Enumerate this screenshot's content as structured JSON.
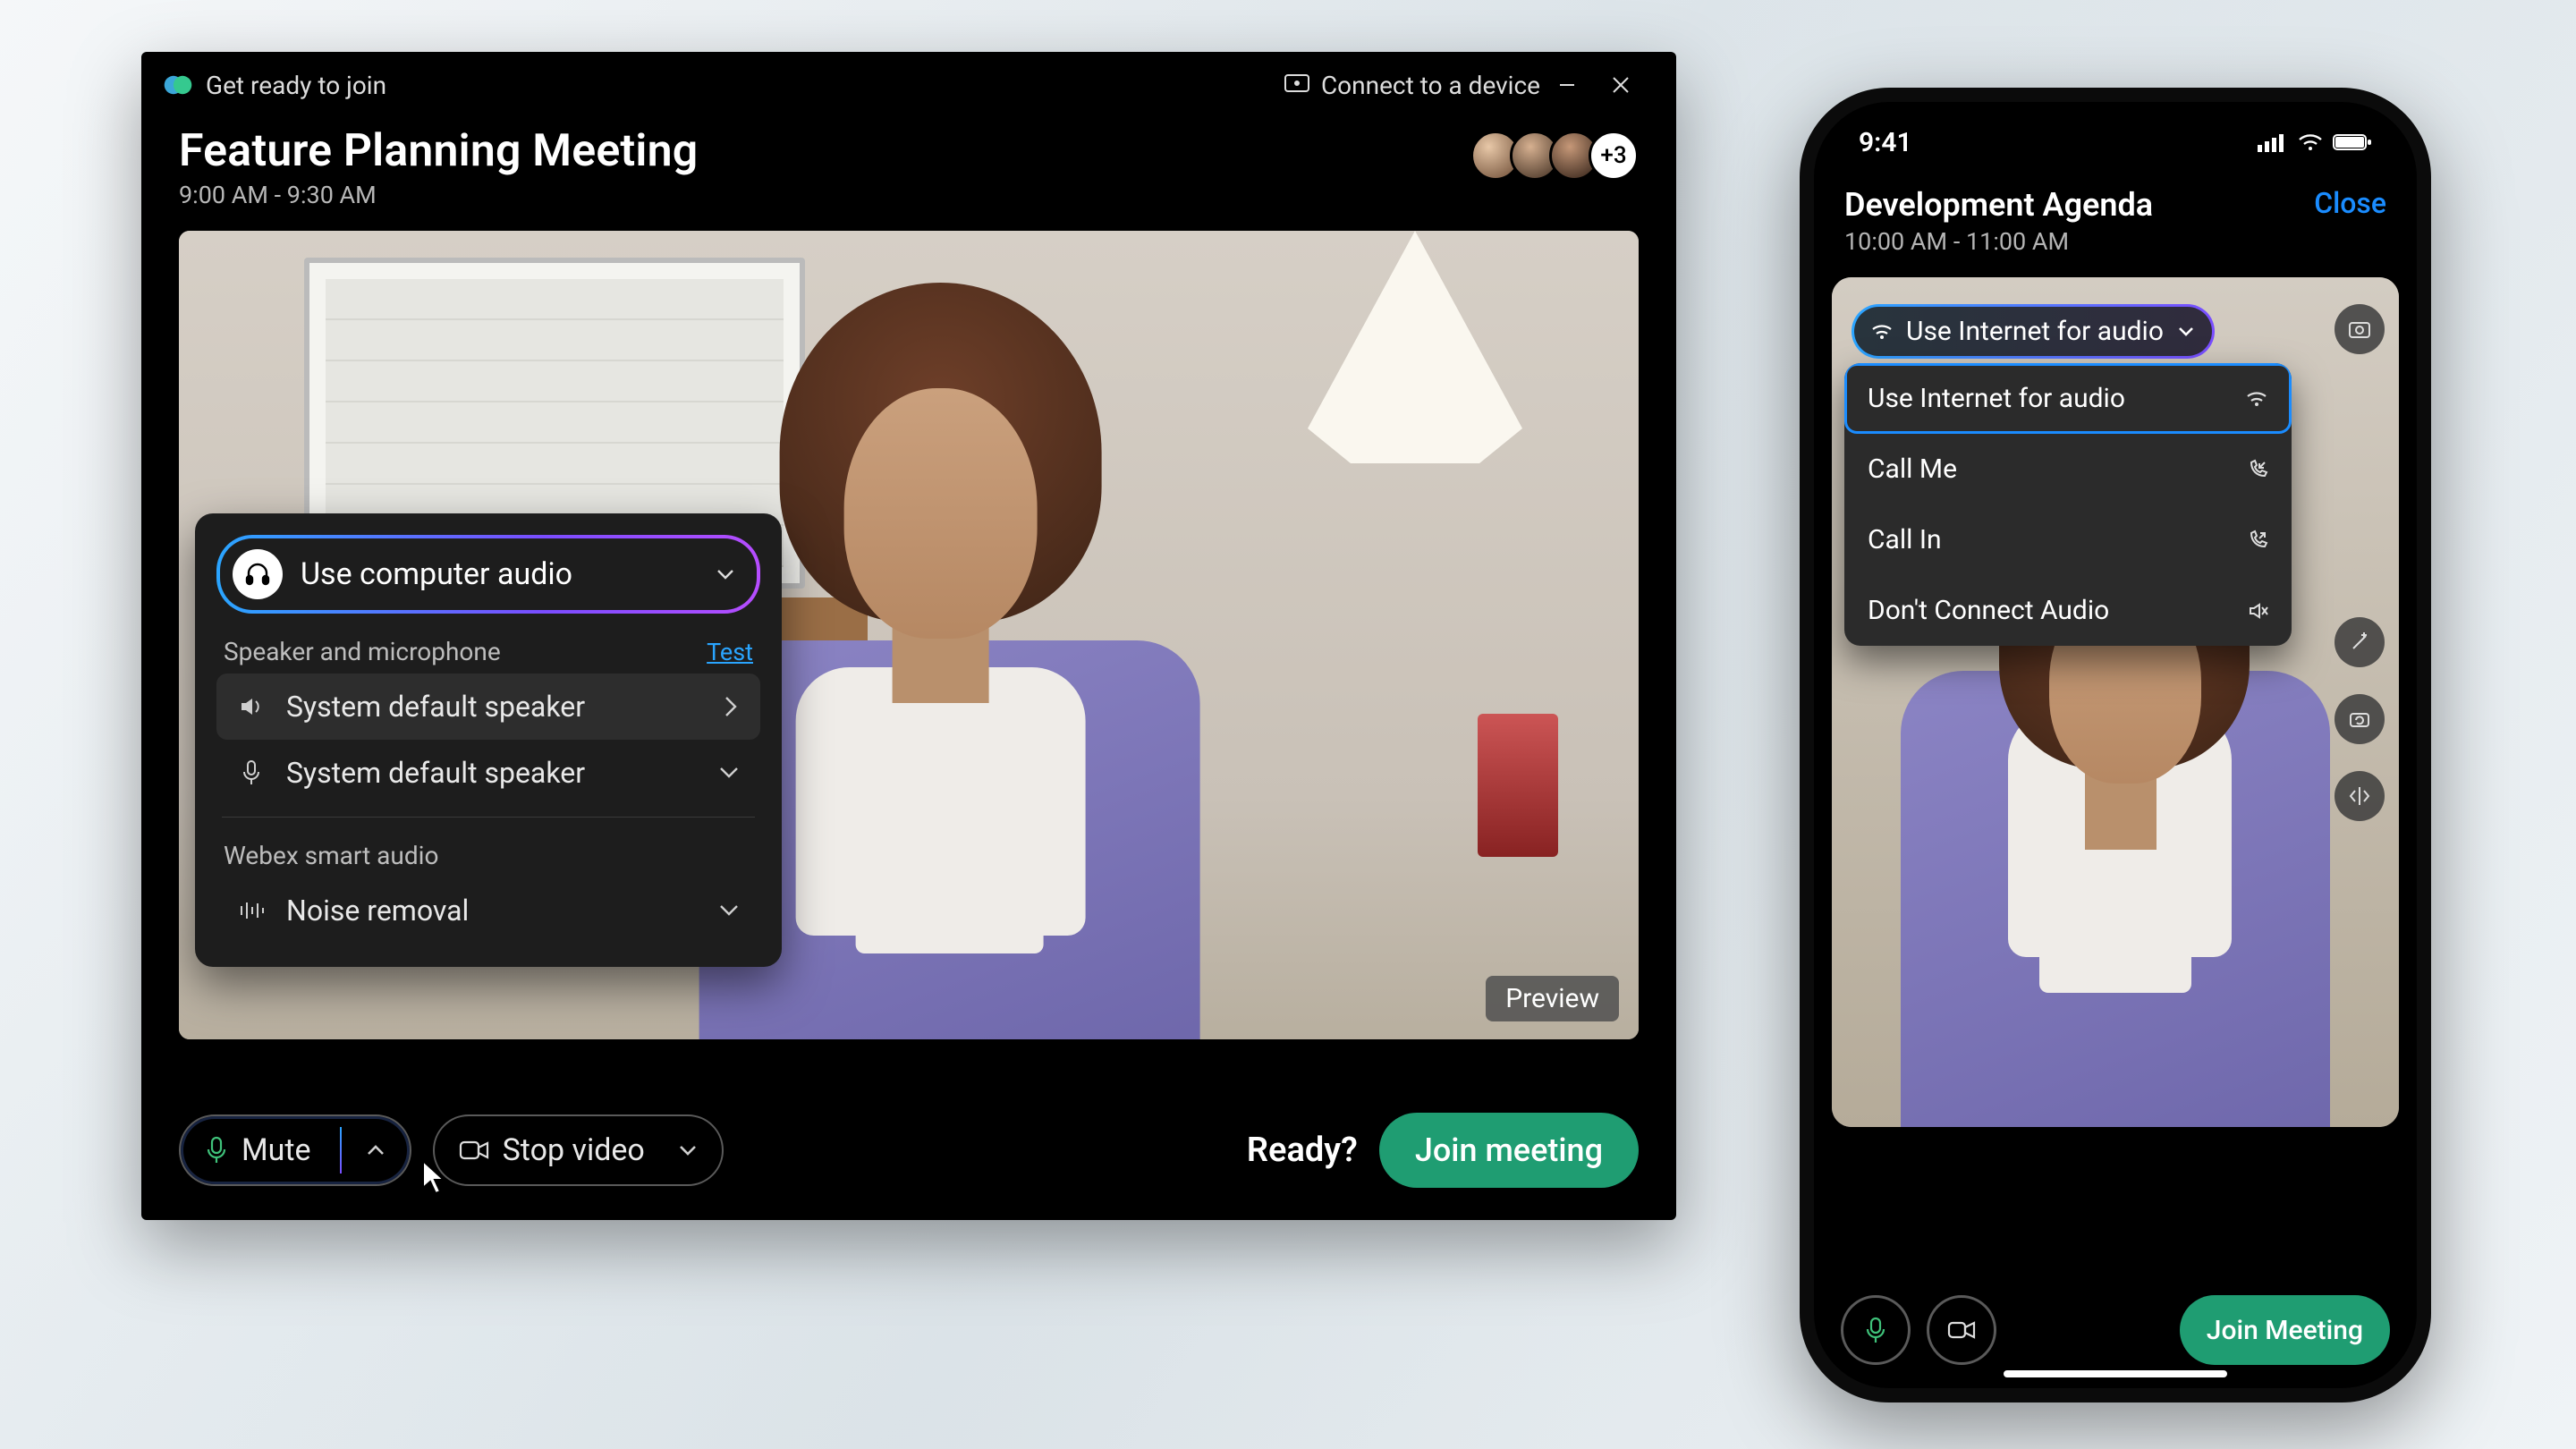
{
  "desktop": {
    "titlebar": {
      "app_label": "Get ready to join",
      "connect": "Connect to a device"
    },
    "meeting": {
      "title": "Feature Planning Meeting",
      "time": "9:00 AM - 9:30 AM",
      "more_count": "+3"
    },
    "preview_badge": "Preview",
    "audio_popover": {
      "primary": "Use computer audio",
      "section1_label": "Speaker and microphone",
      "test_link": "Test",
      "speaker_row": "System default speaker",
      "mic_row": "System default speaker",
      "section2_label": "Webex smart audio",
      "smart_row": "Noise removal"
    },
    "controls": {
      "mute": "Mute",
      "stop_video": "Stop video",
      "ready": "Ready?",
      "join": "Join meeting"
    }
  },
  "phone": {
    "status_time": "9:41",
    "header": {
      "title": "Development Agenda",
      "time": "10:00 AM - 11:00 AM",
      "close": "Close"
    },
    "audio_chip": "Use Internet for audio",
    "menu": {
      "opt1": "Use Internet for audio",
      "opt2": "Call Me",
      "opt3": "Call In",
      "opt4": "Don't Connect Audio"
    },
    "join": "Join Meeting"
  }
}
